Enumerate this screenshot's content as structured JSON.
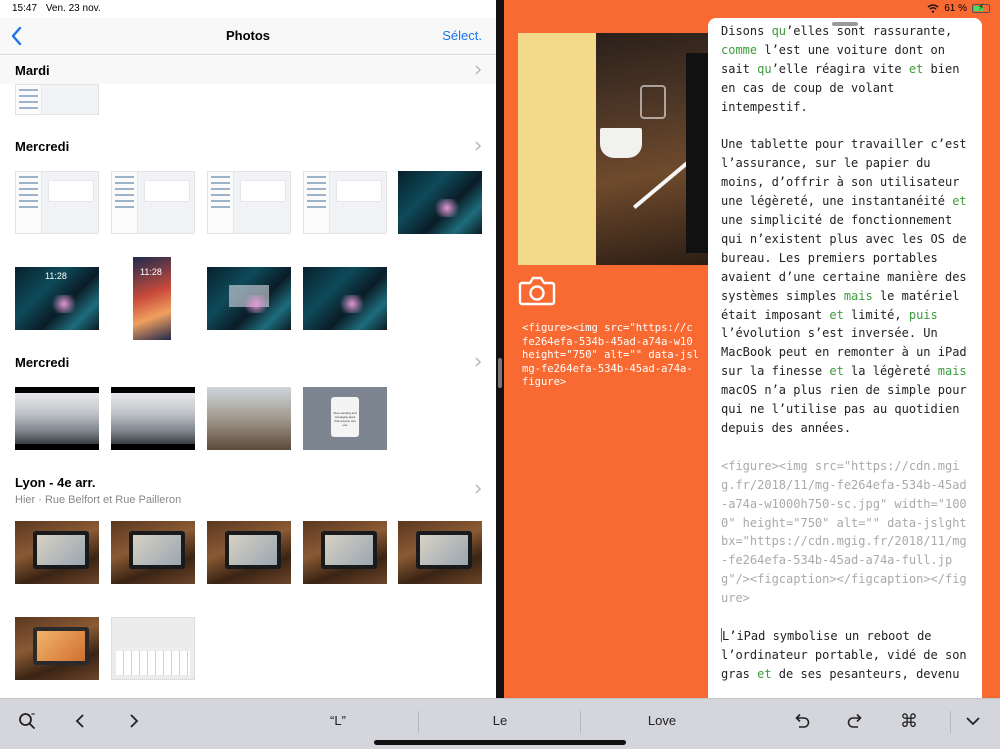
{
  "status_bar": {
    "time": "15:47",
    "date": "Ven. 23 nov.",
    "battery": "61 %",
    "battery_level": 0.61
  },
  "photos": {
    "title": "Photos",
    "back_icon": "chevron-left-icon",
    "select_label": "Sélect.",
    "sections": [
      {
        "title": "Mardi",
        "subtitle": ""
      },
      {
        "title": "Mercredi",
        "subtitle": ""
      },
      {
        "title": "Mercredi",
        "subtitle": ""
      },
      {
        "title": "Lyon - 4e arr.",
        "subtitle": "Hier · Rue Belfort et Rue Pailleron"
      }
    ],
    "thumb_texts": {
      "lock_time": "11:28",
      "dialog_text": "Stop sending and managing apps that anyone can use"
    }
  },
  "editor_pane": {
    "left_code": "<figure><img src=\"https://c\nfe264efa-534b-45ad-a74a-w10\nheight=\"750\" alt=\"\" data-jsl\nmg-fe264efa-534b-45ad-a74a-\nfigure>",
    "paragraphs": [
      [
        {
          "t": "Disons "
        },
        {
          "t": "qu",
          "k": 1
        },
        {
          "t": "’elles sont rassurante, "
        },
        {
          "t": "comme",
          "k": 1
        },
        {
          "t": " l’est une voiture dont on sait "
        },
        {
          "t": "qu",
          "k": 1
        },
        {
          "t": "’elle réagira vite "
        },
        {
          "t": "et",
          "k": 1
        },
        {
          "t": " bien en cas de coup de volant intempestif."
        }
      ],
      [
        {
          "t": "Une tablette pour travailler c’est l’assurance, sur le papier du moins, d’offrir à son utilisateur une légèreté, une instantanéité "
        },
        {
          "t": "et",
          "k": 1
        },
        {
          "t": " une simplicité de fonctionnement qui n’existent plus avec les OS de bureau. Les premiers portables avaient d’une certaine manière des systèmes simples "
        },
        {
          "t": "mais",
          "k": 1
        },
        {
          "t": " le matériel était imposant "
        },
        {
          "t": "et",
          "k": 1
        },
        {
          "t": " limité, "
        },
        {
          "t": "puis",
          "k": 1
        },
        {
          "t": " l’évolution s’est inversée. Un MacBook peut en remonter à un iPad sur la finesse "
        },
        {
          "t": "et",
          "k": 1
        },
        {
          "t": " la légèreté "
        },
        {
          "t": "mais",
          "k": 1
        },
        {
          "t": " macOS n’a plus rien de simple pour qui ne l’utilise pas au quotidien depuis des années."
        }
      ],
      [
        {
          "t": "<figure><img src=\"https://cdn.mgig.fr/2018/11/mg-fe264efa-534b-45ad-a74a-w1000h750-sc.jpg\" width=\"1000\" height=\"750\" alt=\"\" data-jslghtbx=\"https://cdn.mgig.fr/2018/11/mg-fe264efa-534b-45ad-a74a-full.jpg\"/><figcaption></figcaption></figure>",
          "c": 1
        }
      ],
      [
        {
          "t": "L",
          "caret": 1
        },
        {
          "t": "’iPad symbolise un reboot de l’ordinateur portable, vidé de son gras "
        },
        {
          "t": "et",
          "k": 1
        },
        {
          "t": " de ses pesanteurs, devenu"
        }
      ]
    ]
  },
  "toolbar": {
    "suggestions": [
      "“L”",
      "Le",
      "Love"
    ],
    "icons": [
      "search-icon",
      "chevron-left-icon",
      "chevron-right-icon",
      "undo-icon",
      "redo-icon",
      "command-icon",
      "chevron-down-icon"
    ]
  },
  "colors": {
    "accent": "#1a73e8",
    "right_bg": "#f96a33",
    "keyword": "#3c9c3c",
    "code_gray": "#aaaaaa",
    "cover": "#f5d98a"
  }
}
